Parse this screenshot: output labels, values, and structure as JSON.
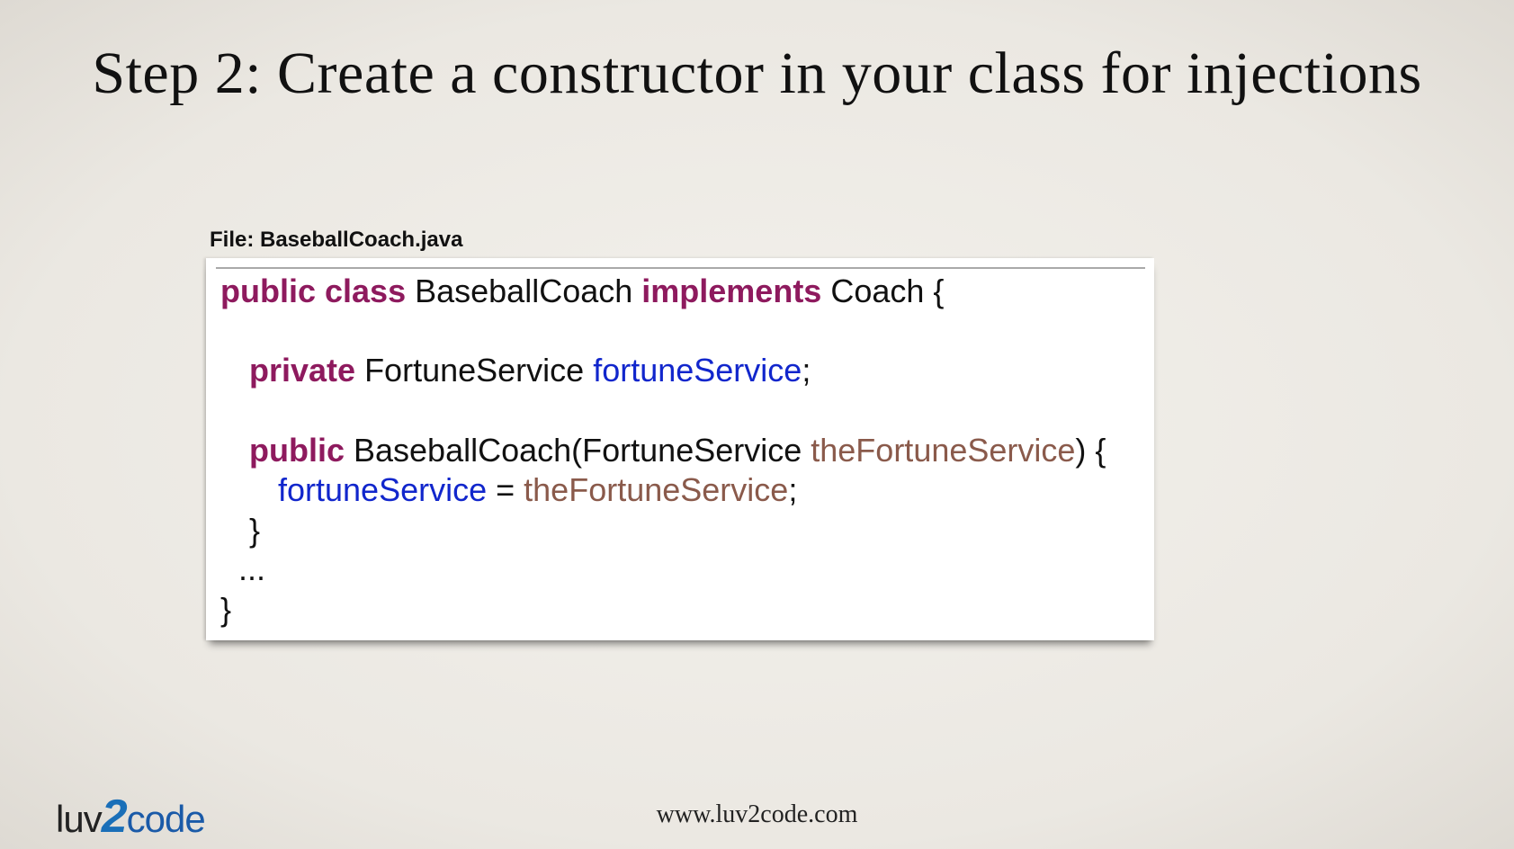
{
  "slide": {
    "title": "Step 2: Create a constructor in your class for injections",
    "file_label": "File: BaseballCoach.java",
    "footer_url": "www.luv2code.com",
    "logo": {
      "part1": "luv",
      "part2": "2",
      "part3": "code"
    },
    "colors": {
      "keyword": "#8e1a5e",
      "field": "#1126cc",
      "parameter": "#8a5a4b",
      "text": "#111111"
    }
  },
  "code": {
    "l1": {
      "kw1": "public class",
      "t1": " BaseballCoach ",
      "kw2": "implements",
      "t2": " Coach {"
    },
    "l2": {
      "kw1": "private",
      "t1": " FortuneService ",
      "f1": "fortuneService",
      "t2": ";"
    },
    "l3": {
      "kw1": "public",
      "t1": " BaseballCoach(FortuneService ",
      "p1": "theFortuneService",
      "t2": ") {"
    },
    "l4": {
      "f1": "fortuneService",
      "t1": " = ",
      "p1": "theFortuneService",
      "t2": ";"
    },
    "l5": {
      "t1": "}"
    },
    "l6": {
      "t1": "..."
    },
    "l7": {
      "t1": "}"
    }
  }
}
